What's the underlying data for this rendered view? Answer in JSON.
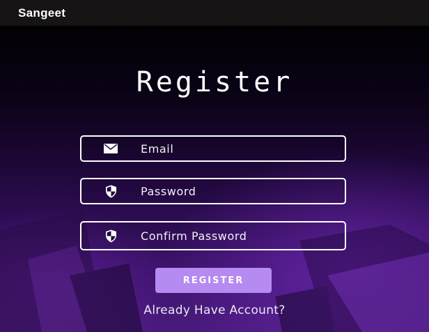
{
  "appbar": {
    "title": "Sangeet"
  },
  "page": {
    "heading": "Register"
  },
  "form": {
    "email": {
      "placeholder": "Email",
      "icon": "mail-icon"
    },
    "password": {
      "placeholder": "Password",
      "icon": "shield-icon"
    },
    "confirm_password": {
      "placeholder": "Confirm Password",
      "icon": "shield-icon"
    },
    "register_label": "REGISTER",
    "account_link": "Already Have Account?"
  },
  "colors": {
    "appbar": "#161414",
    "accent_button": "#b58af1",
    "background_top": "#020104",
    "background_bottom": "#4a1b7e"
  }
}
